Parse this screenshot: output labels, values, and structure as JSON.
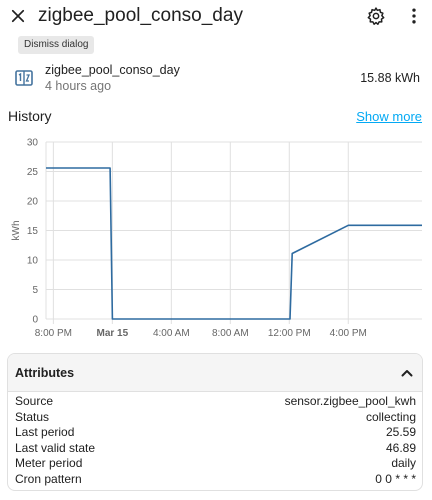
{
  "header": {
    "title": "zigbee_pool_conso_day",
    "close_icon": "close-icon",
    "settings_icon": "gear-icon",
    "more_icon": "more-vertical-icon"
  },
  "tooltip": {
    "text": "Dismiss dialog"
  },
  "entity": {
    "icon": "meter-icon",
    "name": "zigbee_pool_conso_day",
    "last_changed": "4 hours ago",
    "state": "15.88 kWh"
  },
  "history": {
    "title": "History",
    "show_more": "Show more"
  },
  "chart_data": {
    "type": "line",
    "ylabel": "kWh",
    "ylim": [
      0,
      30
    ],
    "y_ticks": [
      "0",
      "5",
      "10",
      "15",
      "20",
      "25",
      "30"
    ],
    "x_ticks": [
      "8:00 PM",
      "Mar 15",
      "4:00 AM",
      "8:00 AM",
      "12:00 PM",
      "4:00 PM"
    ],
    "x_tick_hours": [
      20,
      24,
      28,
      32,
      36,
      40
    ],
    "x_range_hours": [
      19.5,
      45
    ],
    "grid": true,
    "series": [
      {
        "color": "#2e6ba0",
        "points": [
          [
            19.5,
            25.6
          ],
          [
            23.85,
            25.6
          ],
          [
            24.0,
            0
          ],
          [
            36.05,
            0
          ],
          [
            36.2,
            11.1
          ],
          [
            40.0,
            15.88
          ],
          [
            45.0,
            15.88
          ]
        ]
      }
    ]
  },
  "attributes": {
    "title": "Attributes",
    "chevron_icon": "chevron-up-icon",
    "rows": [
      {
        "key": "Source",
        "value": "sensor.zigbee_pool_kwh"
      },
      {
        "key": "Status",
        "value": "collecting"
      },
      {
        "key": "Last period",
        "value": "25.59"
      },
      {
        "key": "Last valid state",
        "value": "46.89"
      },
      {
        "key": "Meter period",
        "value": "daily"
      },
      {
        "key": "Cron pattern",
        "value": "0 0 * * *"
      }
    ]
  }
}
